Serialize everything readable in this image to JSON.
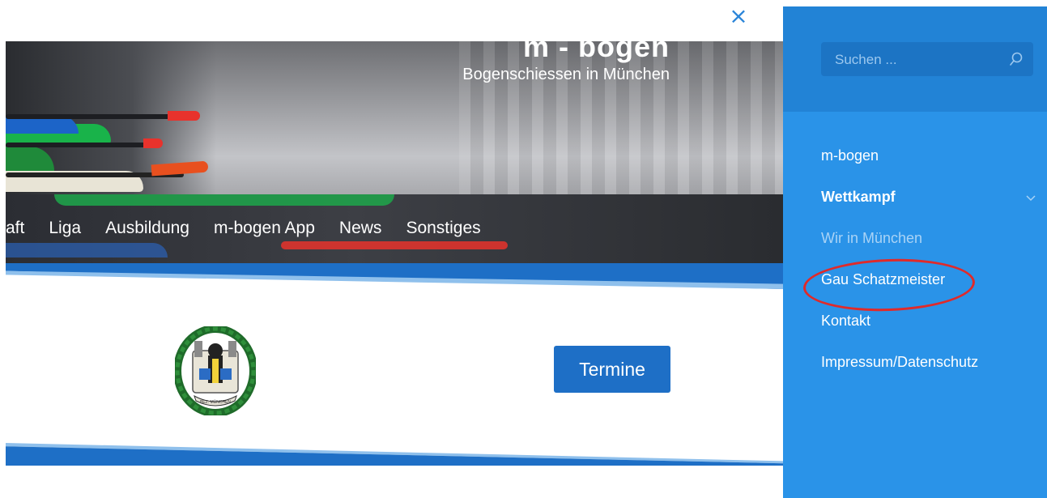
{
  "header": {
    "site_title": "m - bogen",
    "tagline": "Bogenschiessen in München"
  },
  "nav": {
    "items": [
      "aft",
      "Liga",
      "Ausbildung",
      "m-bogen App",
      "News",
      "Sonstiges"
    ]
  },
  "main": {
    "button_label": "Termine",
    "emblem_label": "BEZ. MÜNCHEN"
  },
  "close": {
    "symbol": "×"
  },
  "sidebar": {
    "search_placeholder": "Suchen ...",
    "menu": [
      {
        "label": "m-bogen"
      },
      {
        "label": "Wettkampf"
      },
      {
        "label": "Wir in München"
      },
      {
        "label": "Gau Schatzmeister"
      },
      {
        "label": "Kontakt"
      },
      {
        "label": "Impressum/Datenschutz"
      }
    ]
  },
  "colors": {
    "sidebar_bg": "#2a93e8",
    "sidebar_top": "#2283d6",
    "accent_blue": "#1e6fc6",
    "annotation_red": "#e02a2a"
  }
}
